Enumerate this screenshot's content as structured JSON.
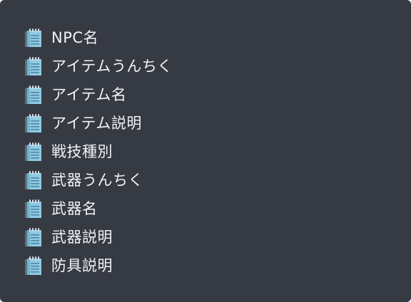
{
  "note_list": {
    "icon": "notepad-icon",
    "items": [
      {
        "label": "NPC名"
      },
      {
        "label": "アイテムうんちく"
      },
      {
        "label": "アイテム名"
      },
      {
        "label": "アイテム説明"
      },
      {
        "label": "戦技種別"
      },
      {
        "label": "武器うんちく"
      },
      {
        "label": "武器名"
      },
      {
        "label": "武器説明"
      },
      {
        "label": "防具説明"
      }
    ]
  },
  "colors": {
    "panel_background": "#363a43",
    "text": "#f2f3f5",
    "icon_page": "#8fcbe3",
    "icon_lines": "#4d86a6",
    "icon_shadow": "#5d6f7e",
    "icon_rings": "#d6dee4"
  }
}
